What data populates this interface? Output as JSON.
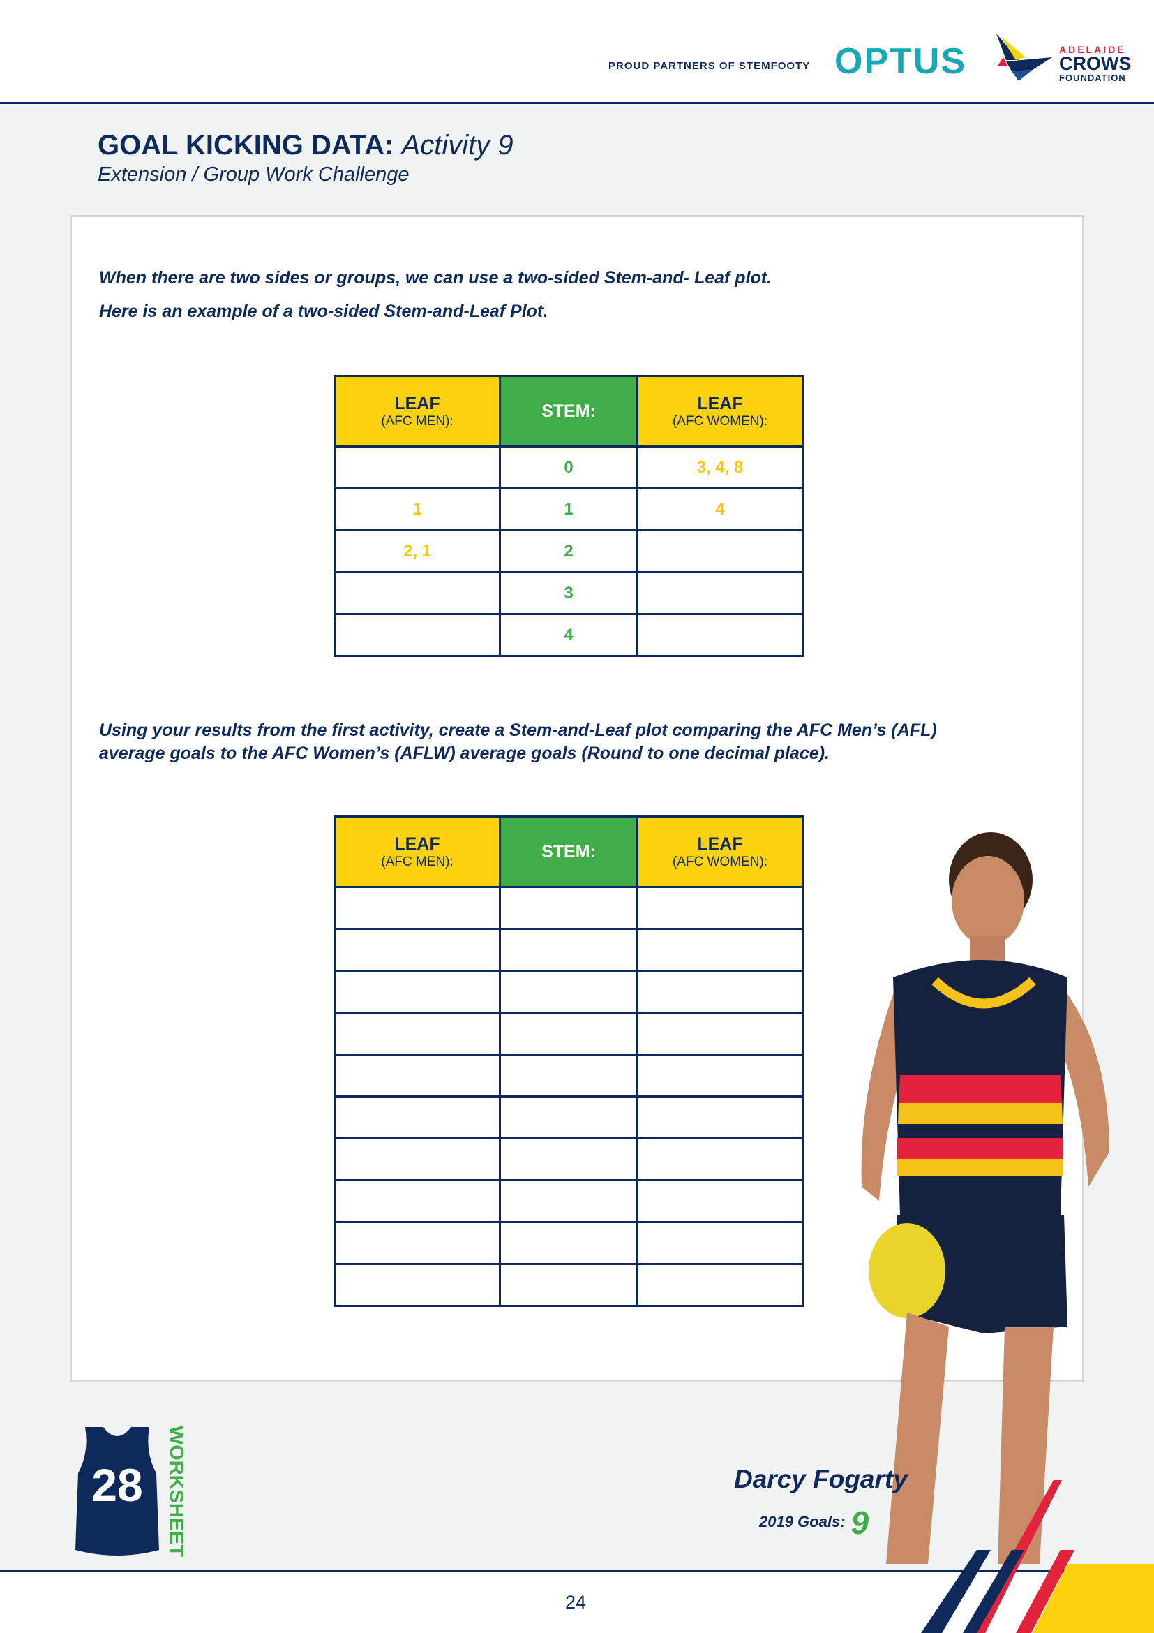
{
  "header": {
    "partners_text": "PROUD PARTNERS OF STEMFOOTY",
    "optus_logo": "OPTUS",
    "crows_logo": {
      "line1": "ADELAIDE",
      "line2": "CROWS",
      "line3": "FOUNDATION"
    }
  },
  "page": {
    "title": "GOAL KICKING DATA:",
    "title_activity": "Activity 9",
    "subtitle": "Extension / Group Work Challenge",
    "intro_line1": "When there are two sides or groups, we can use a two-sided Stem-and- Leaf plot.",
    "intro_line2": "Here is an example of a two-sided Stem-and-Leaf Plot.",
    "task_line1": "Using your results from the first activity, create a Stem-and-Leaf plot comparing the AFC Men’s (AFL)",
    "task_line2": "average goals to the AFC Women’s (AFLW) average goals (Round to one decimal place).",
    "page_number": "24"
  },
  "table_headers": {
    "leaf_label": "LEAF",
    "men_sub": "(AFC MEN):",
    "stem_label": "STEM:",
    "women_sub": "(AFC WOMEN):"
  },
  "example_rows": [
    {
      "men": "",
      "stem": "0",
      "women": "3, 4, 8"
    },
    {
      "men": "1",
      "stem": "1",
      "women": "4"
    },
    {
      "men": "2, 1",
      "stem": "2",
      "women": ""
    },
    {
      "men": "",
      "stem": "3",
      "women": ""
    },
    {
      "men": "",
      "stem": "4",
      "women": ""
    }
  ],
  "blank_rows": 10,
  "player": {
    "name": "Darcy Fogarty",
    "goals_label": "2019 Goals:",
    "goals": "9"
  },
  "worksheet": {
    "jersey_number": "28",
    "label": "WORKSHEET"
  },
  "colors": {
    "navy": "#0e2a5a",
    "yellow": "#fcd20e",
    "green": "#41ad49",
    "red": "#e2233b",
    "teal": "#16a8b4"
  }
}
